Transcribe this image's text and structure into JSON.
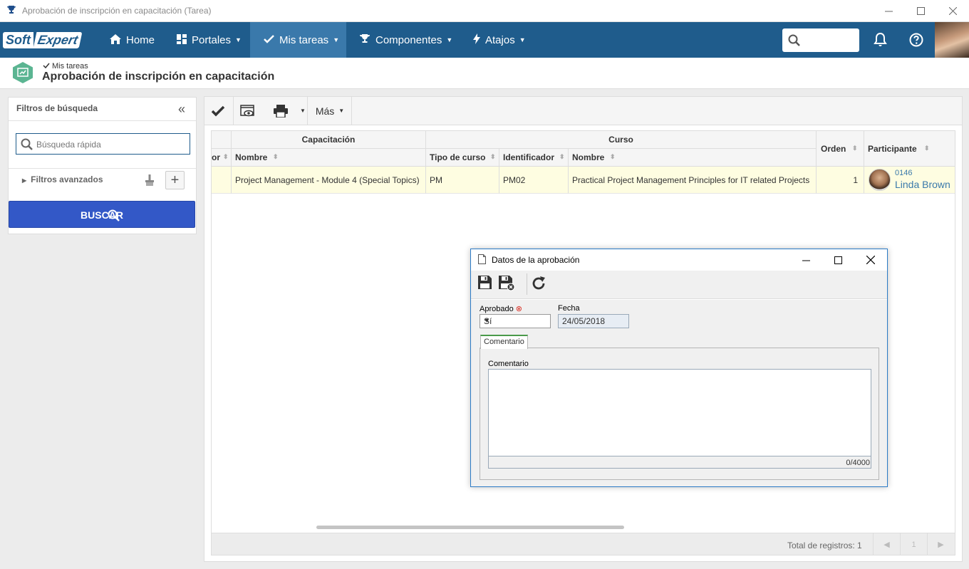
{
  "window": {
    "title": "Aprobación de inscripción en capacitación (Tarea)"
  },
  "nav": {
    "logo_soft": "Soft",
    "logo_expert": "Expert",
    "items": [
      {
        "label": "Home",
        "icon": "home-icon"
      },
      {
        "label": "Portales",
        "icon": "dashboard-icon"
      },
      {
        "label": "Mis tareas",
        "icon": "check-icon"
      },
      {
        "label": "Componentes",
        "icon": "trophy-icon"
      },
      {
        "label": "Atajos",
        "icon": "bolt-icon"
      }
    ],
    "active": "Mis tareas",
    "search_value": ""
  },
  "header": {
    "breadcrumb": "Mis tareas",
    "title": "Aprobación de inscripción en capacitación"
  },
  "filters": {
    "title": "Filtros de búsqueda",
    "quick_search_placeholder": "Búsqueda rápida",
    "advanced_label": "Filtros avanzados",
    "search_button": "BUSCAR"
  },
  "toolbar": {
    "more_label": "Más"
  },
  "grid": {
    "group_headers": {
      "capacitacion": "Capacitación",
      "curso": "Curso"
    },
    "columns": {
      "partial": "or",
      "nombre_cap": "Nombre",
      "tipo_curso": "Tipo de curso",
      "identificador": "Identificador",
      "nombre_curso": "Nombre",
      "orden": "Orden",
      "participante": "Participante"
    },
    "rows": [
      {
        "nombre_cap": "Project Management - Module 4 (Special Topics)",
        "tipo_curso": "PM",
        "identificador": "PM02",
        "nombre_curso": "Practical Project Management Principles for IT related Projects",
        "orden": "1",
        "participante_id": "0146",
        "participante_nombre": "Linda Brown"
      }
    ],
    "total_label": "Total de registros: 1",
    "page": "1"
  },
  "dialog": {
    "title": "Datos de la aprobación",
    "aprobado_label": "Aprobado",
    "aprobado_value": "Sí",
    "fecha_label": "Fecha",
    "fecha_value": "24/05/2018",
    "tab_label": "Comentario",
    "comment_label": "Comentario",
    "comment_value": "",
    "counter": "0/4000"
  },
  "colors": {
    "nav_bg": "#1f5c8c",
    "nav_active": "#3a79ab",
    "search_button": "#3358c7",
    "row_highlight": "#fefde1",
    "dialog_border": "#2c7bc6"
  }
}
